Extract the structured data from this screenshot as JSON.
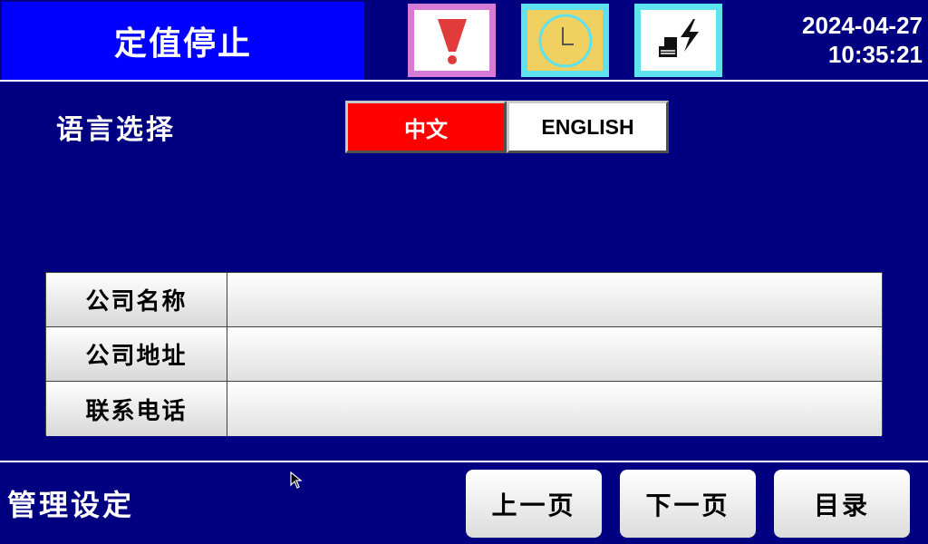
{
  "header": {
    "status_title": "定值停止",
    "icons": {
      "alarm": "alarm-exclamation-icon",
      "clock": "clock-icon",
      "power": "power-lightning-icon"
    },
    "date": "2024-04-27",
    "time": "10:35:21"
  },
  "language": {
    "label": "语言选择",
    "options": [
      {
        "label": "中文",
        "selected": true
      },
      {
        "label": "ENGLISH",
        "selected": false
      }
    ]
  },
  "company_info": {
    "rows": [
      {
        "label": "公司名称",
        "value": ""
      },
      {
        "label": "公司地址",
        "value": ""
      },
      {
        "label": "联系电话",
        "value": ""
      }
    ]
  },
  "footer": {
    "title": "管理设定",
    "prev_label": "上一页",
    "next_label": "下一页",
    "menu_label": "目录"
  },
  "colors": {
    "background": "#000080",
    "title_bg": "#0000ff",
    "selected_lang": "#ff0000",
    "alarm_frame": "#d67bd6",
    "clock_fill": "#f0d060",
    "icon_frame": "#5ee3ee"
  }
}
